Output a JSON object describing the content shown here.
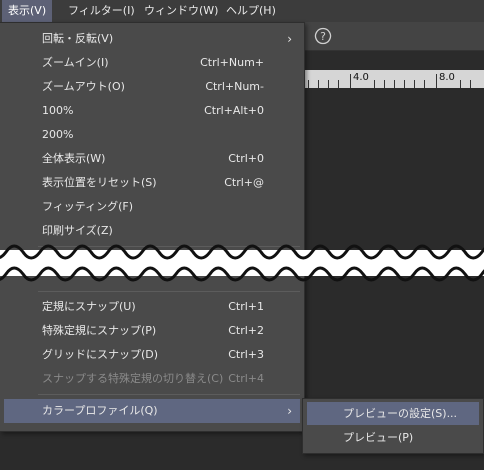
{
  "menubar": {
    "items": [
      {
        "label": "表示(V)"
      },
      {
        "label": "フィルター(I)"
      },
      {
        "label": "ウィンドウ(W)"
      },
      {
        "label": "ヘルプ(H)"
      }
    ]
  },
  "ruler": {
    "labels": [
      "4.0",
      "8.0"
    ]
  },
  "view_menu": {
    "items": [
      {
        "label": "回転・反転(V)",
        "shortcut": "",
        "submenu": true
      },
      {
        "label": "ズームイン(I)",
        "shortcut": "Ctrl+Num+"
      },
      {
        "label": "ズームアウト(O)",
        "shortcut": "Ctrl+Num-"
      },
      {
        "label": "100%",
        "shortcut": "Ctrl+Alt+0"
      },
      {
        "label": "200%",
        "shortcut": ""
      },
      {
        "label": "全体表示(W)",
        "shortcut": "Ctrl+0"
      },
      {
        "label": "表示位置をリセット(S)",
        "shortcut": "Ctrl+@"
      },
      {
        "label": "フィッティング(F)",
        "shortcut": ""
      },
      {
        "label": "印刷サイズ(Z)",
        "shortcut": ""
      },
      {
        "label": "定規にスナップ(U)",
        "shortcut": "Ctrl+1"
      },
      {
        "label": "特殊定規にスナップ(P)",
        "shortcut": "Ctrl+2"
      },
      {
        "label": "グリッドにスナップ(D)",
        "shortcut": "Ctrl+3"
      },
      {
        "label": "スナップする特殊定規の切り替え(C)",
        "shortcut": "Ctrl+4",
        "disabled": true
      },
      {
        "label": "カラープロファイル(Q)",
        "shortcut": "",
        "submenu": true,
        "highlighted": true
      }
    ]
  },
  "color_profile_submenu": {
    "items": [
      {
        "label": "プレビューの設定(S)...",
        "highlighted": true
      },
      {
        "label": "プレビュー(P)"
      }
    ]
  },
  "colors": {
    "menu_bg": "#4a4a4a",
    "highlight": "#5f6781",
    "menubar_bg": "#3c3c3c",
    "active_tab": "#5d6176",
    "disabled_text": "#8a8a8a"
  }
}
